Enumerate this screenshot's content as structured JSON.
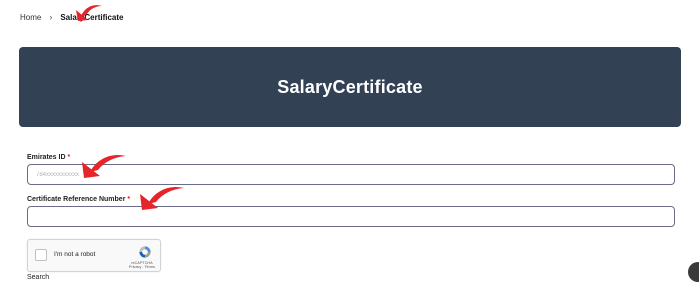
{
  "breadcrumb": {
    "home_label": "Home",
    "separator": "›",
    "current_label": "SalaryCertificate"
  },
  "banner": {
    "title": "SalaryCertificate",
    "background": "#334155"
  },
  "form": {
    "emirates_id": {
      "label": "Emirates ID",
      "required_mark": "*",
      "placeholder": "784xxxxxxxxxxx"
    },
    "certificate_reference": {
      "label": "Certificate Reference Number",
      "required_mark": "*",
      "placeholder": ""
    }
  },
  "captcha": {
    "checkbox_label": "I'm not a robot",
    "brand": "reCAPTCHA",
    "links": "Privacy - Terms"
  },
  "actions": {
    "search_label": "Search"
  },
  "annotation": {
    "arrow_color": "#e5252a"
  }
}
